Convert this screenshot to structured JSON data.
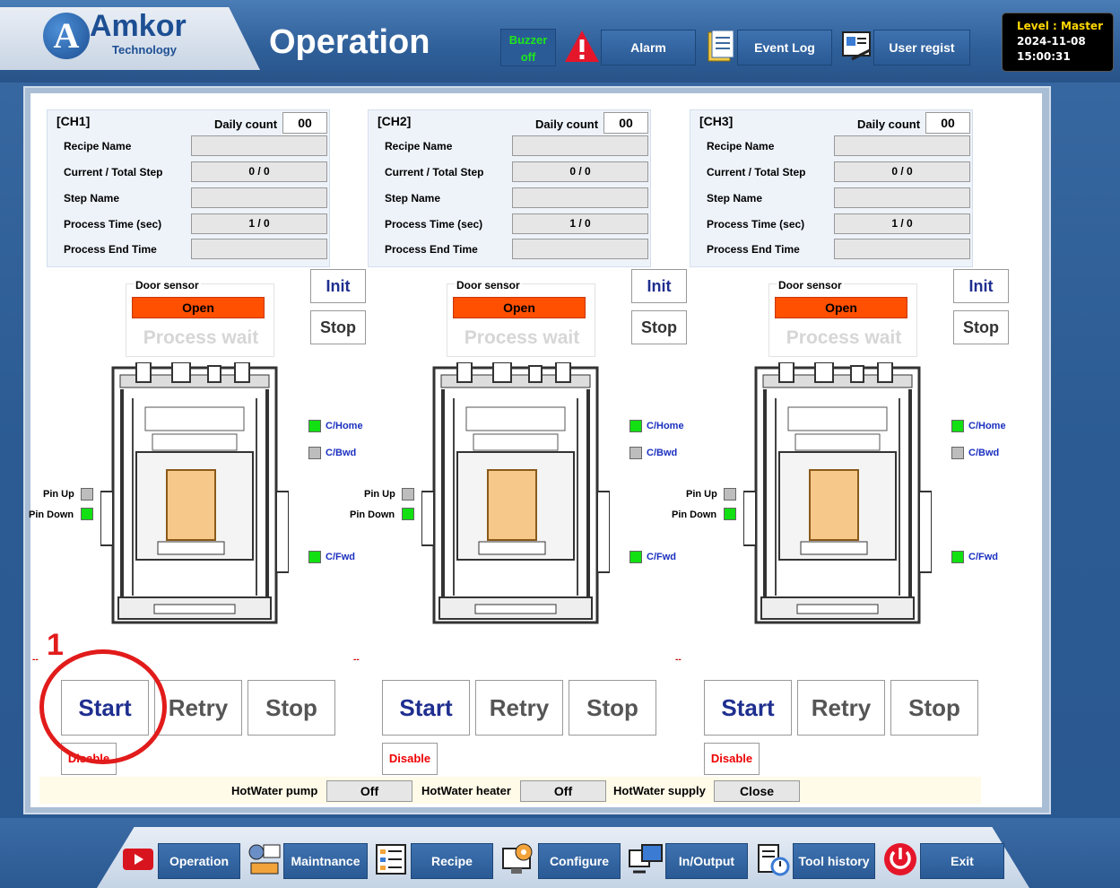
{
  "header": {
    "logo": "Amkor",
    "logo_sub": "Technology",
    "title": "Operation",
    "buzzer_line1": "Buzzer",
    "buzzer_line2": "off",
    "alarm_label": "Alarm",
    "event_log_label": "Event Log",
    "user_regist_label": "User regist",
    "level_label": "Level : Master",
    "date": "2024-11-08",
    "time": "15:00:31"
  },
  "labels": {
    "daily_count": "Daily count",
    "recipe_name": "Recipe Name",
    "current_total_step": "Current / Total Step",
    "step_name": "Step Name",
    "process_time": "Process Time (sec)",
    "process_end_time": "Process End Time",
    "door_sensor": "Door sensor",
    "init": "Init",
    "stop": "Stop",
    "start": "Start",
    "retry": "Retry",
    "disable": "Disable",
    "c_home": "C/Home",
    "c_bwd": "C/Bwd",
    "c_fwd": "C/Fwd",
    "pin_up": "Pin Up",
    "pin_down": "Pin Down",
    "dash": "--"
  },
  "channels": [
    {
      "title": "[CH1]",
      "daily_count": "00",
      "recipe_name": "",
      "step": "0 / 0",
      "step_name": "",
      "process_time": "1 / 0",
      "end_time": "",
      "door_status": "Open",
      "process_state": "Process wait"
    },
    {
      "title": "[CH2]",
      "daily_count": "00",
      "recipe_name": "",
      "step": "0 / 0",
      "step_name": "",
      "process_time": "1 / 0",
      "end_time": "",
      "door_status": "Open",
      "process_state": "Process wait"
    },
    {
      "title": "[CH3]",
      "daily_count": "00",
      "recipe_name": "",
      "step": "0 / 0",
      "step_name": "",
      "process_time": "1 / 0",
      "end_time": "",
      "door_status": "Open",
      "process_state": "Process wait"
    }
  ],
  "hotwater": {
    "pump_label": "HotWater pump",
    "pump_value": "Off",
    "heater_label": "HotWater heater",
    "heater_value": "Off",
    "supply_label": "HotWater supply",
    "supply_value": "Close"
  },
  "annotation": {
    "number": "1"
  },
  "nav": {
    "operation": "Operation",
    "maintnance": "Maintnance",
    "recipe": "Recipe",
    "configure": "Configure",
    "inoutput": "In/Output",
    "tool_history": "Tool history",
    "exit": "Exit"
  },
  "colors": {
    "accent_blue": "#1f2f8f",
    "door_open": "#ff4f00",
    "indicator_on": "#12e012",
    "indicator_off": "#bdbdbd",
    "alert_red": "#e21b1b"
  }
}
